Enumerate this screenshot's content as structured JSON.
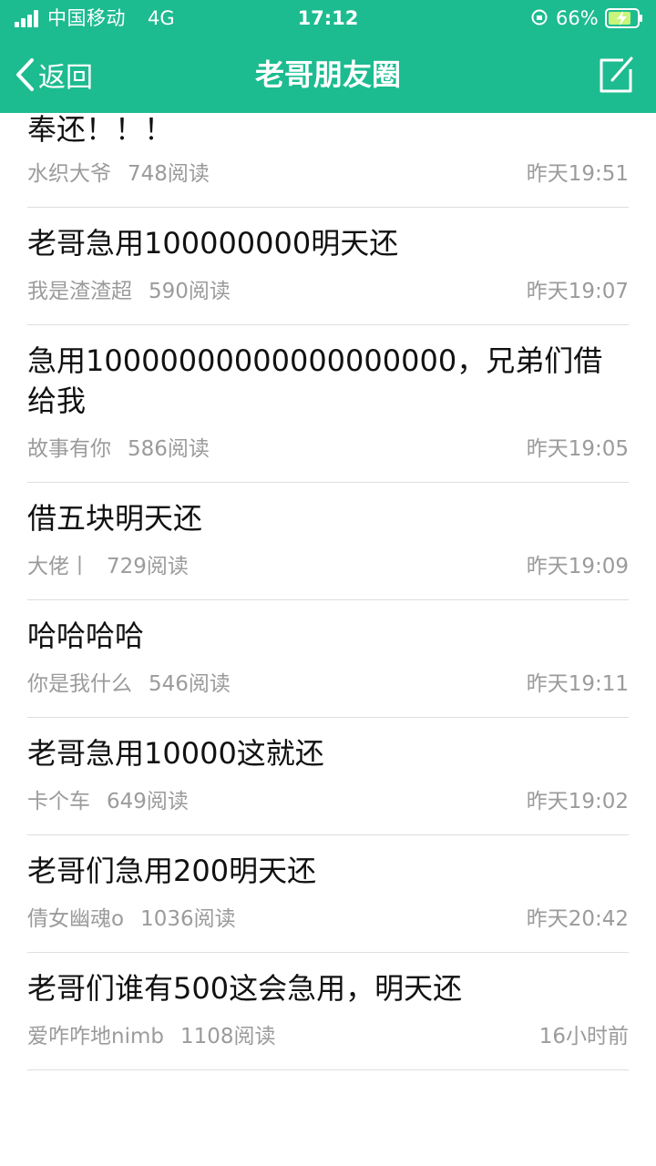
{
  "status_bar": {
    "carrier": "中国移动",
    "network": "4G",
    "time": "17:12",
    "battery": "66%"
  },
  "nav": {
    "back_label": "返回",
    "title": "老哥朋友圈"
  },
  "posts": [
    {
      "title": "奉还！！！",
      "author": "水织大爷",
      "reads": "748阅读",
      "time": "昨天19:51"
    },
    {
      "title": "老哥急用100000000明天还",
      "author": "我是渣渣超",
      "reads": "590阅读",
      "time": "昨天19:07"
    },
    {
      "title": "急用10000000000000000000，兄弟们借给我",
      "author": "故事有你",
      "reads": "586阅读",
      "time": "昨天19:05"
    },
    {
      "title": "借五块明天还",
      "author": "大佬丨",
      "reads": "729阅读",
      "time": "昨天19:09"
    },
    {
      "title": "哈哈哈哈",
      "author": "你是我什么",
      "reads": "546阅读",
      "time": "昨天19:11"
    },
    {
      "title": "老哥急用10000这就还",
      "author": "卡个车",
      "reads": "649阅读",
      "time": "昨天19:02"
    },
    {
      "title": "老哥们急用200明天还",
      "author": "倩女幽魂o",
      "reads": "1036阅读",
      "time": "昨天20:42"
    },
    {
      "title": "老哥们谁有500这会急用，明天还",
      "author": "爱咋咋地nimb",
      "reads": "1108阅读",
      "time": "16小时前"
    }
  ],
  "colors": {
    "header": "#1dbb90",
    "title_text": "#111111",
    "meta_text": "#9b9b9b",
    "divider": "#dedede"
  }
}
